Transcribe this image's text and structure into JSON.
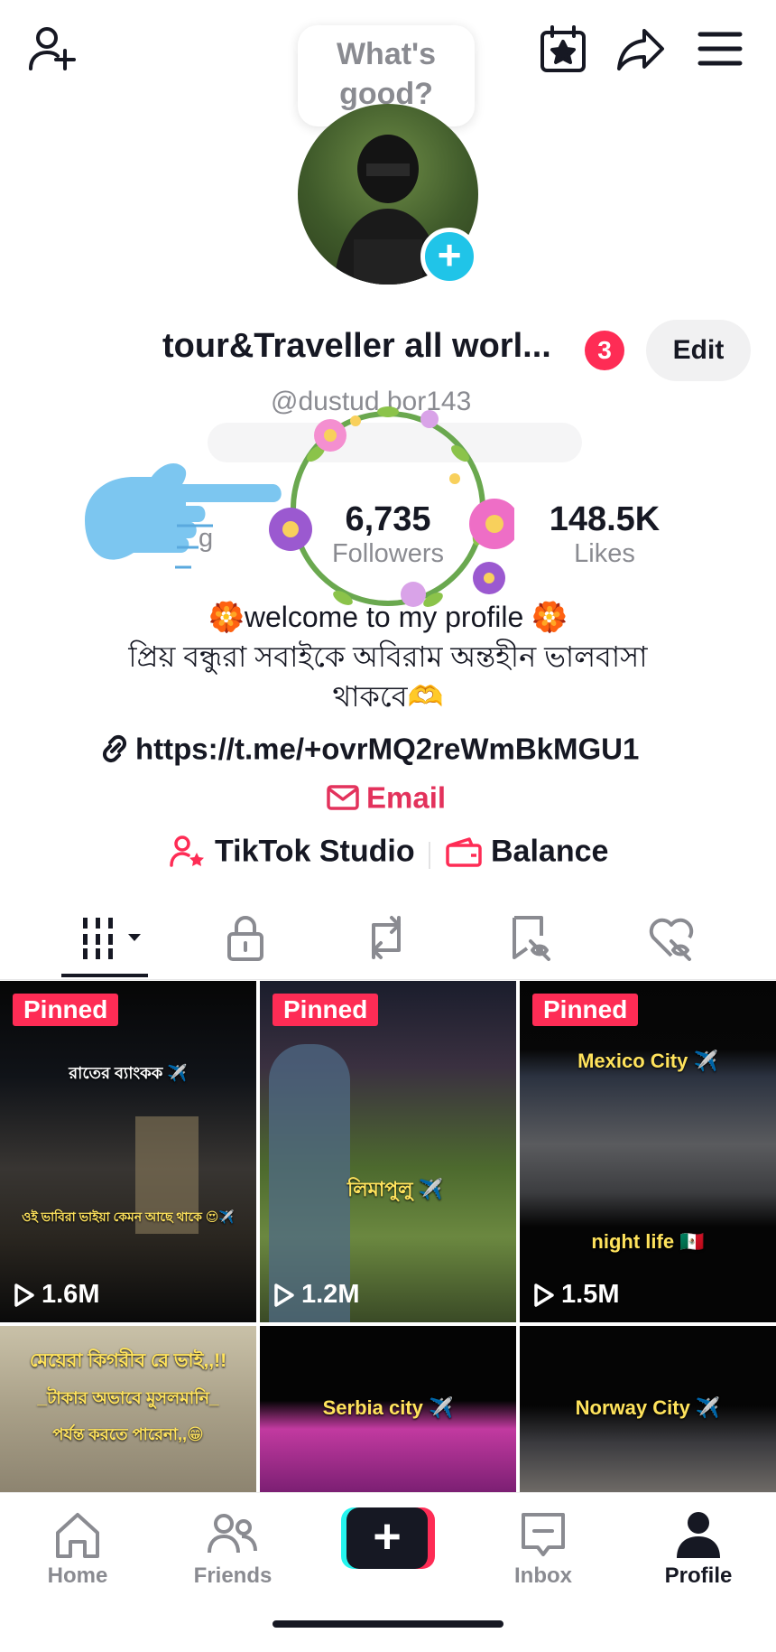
{
  "bubble": {
    "line1": "What's",
    "line2": "good?"
  },
  "profile": {
    "name": "tour&Traveller all worl...",
    "notification_count": "3",
    "edit_label": "Edit",
    "username": "@dustud bor143"
  },
  "stats": {
    "following_label_fragment": "g",
    "followers_value": "6,735",
    "followers_label": "Followers",
    "likes_value": "148.5K",
    "likes_label": "Likes"
  },
  "bio": {
    "line1": "🏵️welcome to my profile 🏵️",
    "line2": "প্রিয় বন্ধুরা সবাইকে অবিরাম অন্তহীন ভালবাসা",
    "line3": "থাকবে🫶"
  },
  "link": {
    "url": "https://t.me/+ovrMQ2reWmBkMGU1"
  },
  "email_label": "Email",
  "tools": {
    "studio_label": "TikTok Studio",
    "balance_label": "Balance"
  },
  "tabs": [
    "videos",
    "private",
    "reposts",
    "favorites",
    "liked"
  ],
  "videos": [
    {
      "pinned": "Pinned",
      "views": "1.6M",
      "caption": "রাতের ব্যাংকক ✈️",
      "caption2": "ওই ভাবিরা ভাইয়া কেমন আছে থাকে 😍✈️"
    },
    {
      "pinned": "Pinned",
      "views": "1.2M",
      "caption": "লিমাপুলু ✈️",
      "caption2": ""
    },
    {
      "pinned": "Pinned",
      "views": "1.5M",
      "caption": "Mexico City ✈️",
      "caption2": "night life 🇲🇽"
    },
    {
      "pinned": "",
      "views": "",
      "caption": "মেয়েরা কিগরীব রে ভাই,,!!",
      "caption2": "_টাকার অভাবে মুসলমানি_",
      "caption3": "পর্যন্ত করতে পারেনা,,😁"
    },
    {
      "pinned": "",
      "views": "",
      "caption": "Serbia city ✈️",
      "caption2": ""
    },
    {
      "pinned": "",
      "views": "",
      "caption": "Norway City ✈️",
      "caption2": ""
    }
  ],
  "bottom_nav": {
    "home": "Home",
    "friends": "Friends",
    "inbox": "Inbox",
    "profile": "Profile"
  },
  "colors": {
    "accent": "#fe2c55",
    "email": "#e3325c",
    "cyan": "#20c4e8"
  }
}
